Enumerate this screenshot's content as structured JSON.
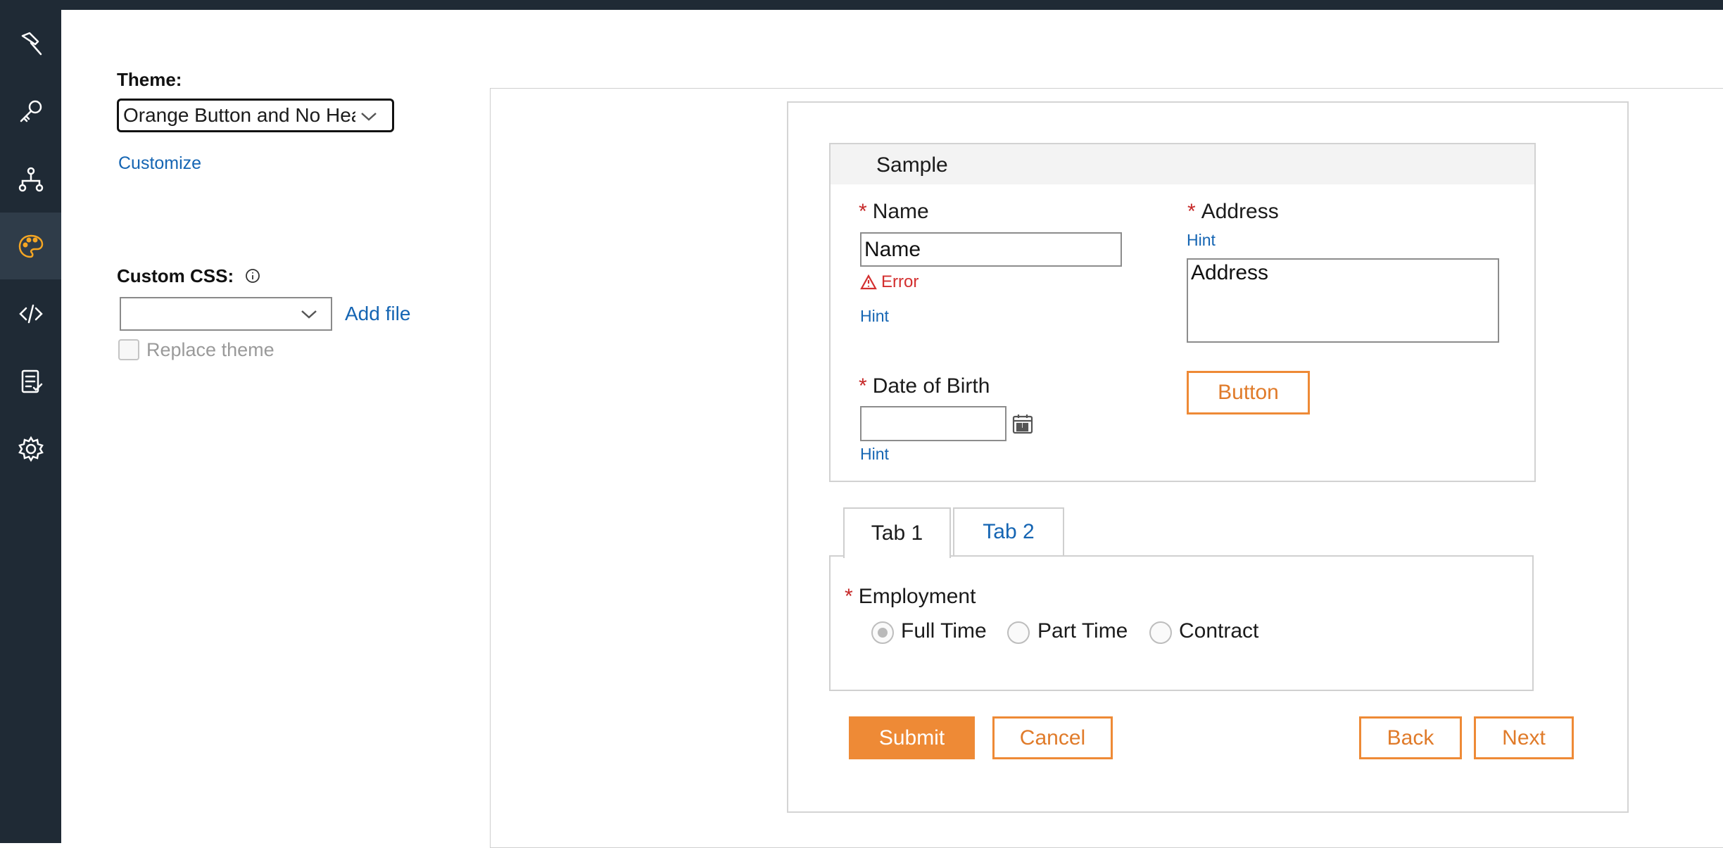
{
  "rail": {
    "items": [
      {
        "icon": "hammer-icon"
      },
      {
        "icon": "key-icon"
      },
      {
        "icon": "sitemap-icon"
      },
      {
        "icon": "palette-icon",
        "active": true
      },
      {
        "icon": "code-icon"
      },
      {
        "icon": "checklist-icon"
      },
      {
        "icon": "gear-icon"
      }
    ]
  },
  "theme": {
    "label": "Theme:",
    "selected": "Orange Button and No Header",
    "customize_link": "Customize"
  },
  "custom_css": {
    "label": "Custom CSS:",
    "add_file": "Add file",
    "replace_theme": "Replace theme"
  },
  "sample": {
    "title": "Sample",
    "name": {
      "label": "Name",
      "value": "Name",
      "error": "Error",
      "hint": "Hint"
    },
    "address": {
      "label": "Address",
      "hint": "Hint",
      "value": "Address"
    },
    "dob": {
      "label": "Date of Birth",
      "hint": "Hint"
    },
    "button_label": "Button",
    "required_mark": "*"
  },
  "tabs": [
    "Tab 1",
    "Tab 2"
  ],
  "employment": {
    "label": "Employment",
    "options": [
      "Full Time",
      "Part Time",
      "Contract"
    ],
    "selected": "Full Time"
  },
  "actions": {
    "submit": "Submit",
    "cancel": "Cancel",
    "back": "Back",
    "next": "Next"
  },
  "colors": {
    "rail": "#1f2a35",
    "accent": "#ee8a36",
    "link": "#1565b3",
    "active_icon": "#f5a623",
    "error": "#d32f2f"
  }
}
